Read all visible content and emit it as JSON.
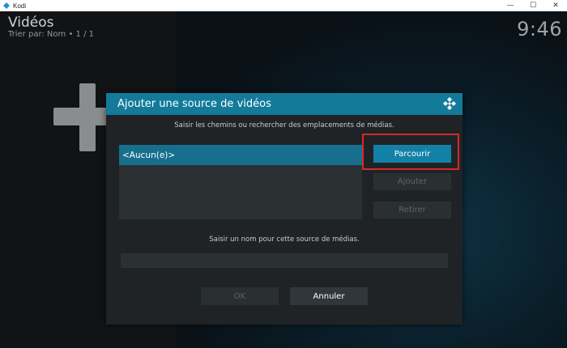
{
  "window": {
    "title": "Kodi",
    "minimize_glyph": "—",
    "maximize_glyph": "☐",
    "close_glyph": "✕"
  },
  "page": {
    "title": "Vidéos",
    "subtitle": "Trier par: Nom  •  1 / 1",
    "clock": "9:46",
    "add_icon": "plus-icon"
  },
  "dialog": {
    "title": "Ajouter une source de vidéos",
    "logo_icon": "kodi-logo-icon",
    "paths_hint": "Saisir les chemins ou rechercher des emplacements de médias.",
    "paths": [
      "<Aucun(e)>"
    ],
    "browse_label": "Parcourir",
    "add_label": "Ajouter",
    "remove_label": "Retirer",
    "name_hint": "Saisir un nom pour cette source de médias.",
    "name_value": "",
    "ok_label": "OK",
    "cancel_label": "Annuler"
  },
  "colors": {
    "accent": "#137a9a",
    "selected": "#166f8c",
    "annotation": "#d8282b"
  }
}
